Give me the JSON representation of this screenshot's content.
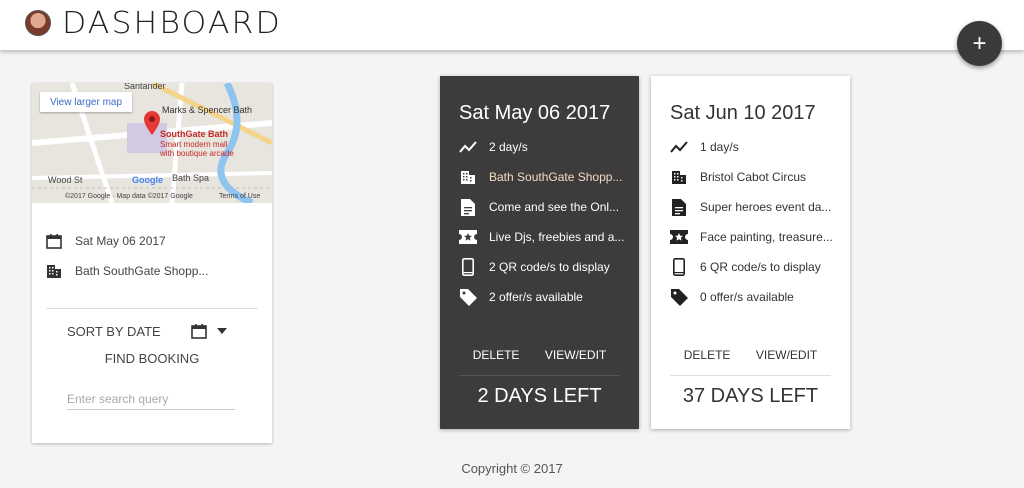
{
  "header": {
    "title": "DASHBOARD",
    "add_label": "+"
  },
  "map": {
    "larger_link": "View larger map",
    "labels": {
      "santander": "Santander",
      "ms": "Marks & Spencer Bath",
      "place_name": "SouthGate Bath",
      "place_desc1": "Smart modern mall",
      "place_desc2": "with boutique arcade",
      "wood": "Wood St",
      "spa": "Bath Spa",
      "credit": "©2017 Google · Map data ©2017 Google",
      "terms": "Terms of Use",
      "google": "Google"
    }
  },
  "sidebar": {
    "date": "Sat May 06 2017",
    "venue": "Bath SouthGate Shopp...",
    "sort_label": "SORT BY DATE",
    "find_label": "FIND BOOKING",
    "search_placeholder": "Enter search query"
  },
  "cards": [
    {
      "date": "Sat May 06 2017",
      "frequency": "2 day/s",
      "venue": "Bath SouthGate Shopp...",
      "description": "Come and see the Onl...",
      "features": "Live Djs, freebies and a...",
      "qr": "2 QR code/s to display",
      "offers": "2 offer/s available",
      "delete_label": "DELETE",
      "view_label": "VIEW/EDIT",
      "days_left": "2 DAYS LEFT"
    },
    {
      "date": "Sat Jun 10 2017",
      "frequency": "1 day/s",
      "venue": "Bristol Cabot Circus",
      "description": "Super heroes event da...",
      "features": "Face painting, treasure...",
      "qr": "6 QR code/s to display",
      "offers": "0 offer/s available",
      "delete_label": "DELETE",
      "view_label": "VIEW/EDIT",
      "days_left": "37 DAYS LEFT"
    }
  ],
  "footer": {
    "copyright": "Copyright © 2017"
  }
}
